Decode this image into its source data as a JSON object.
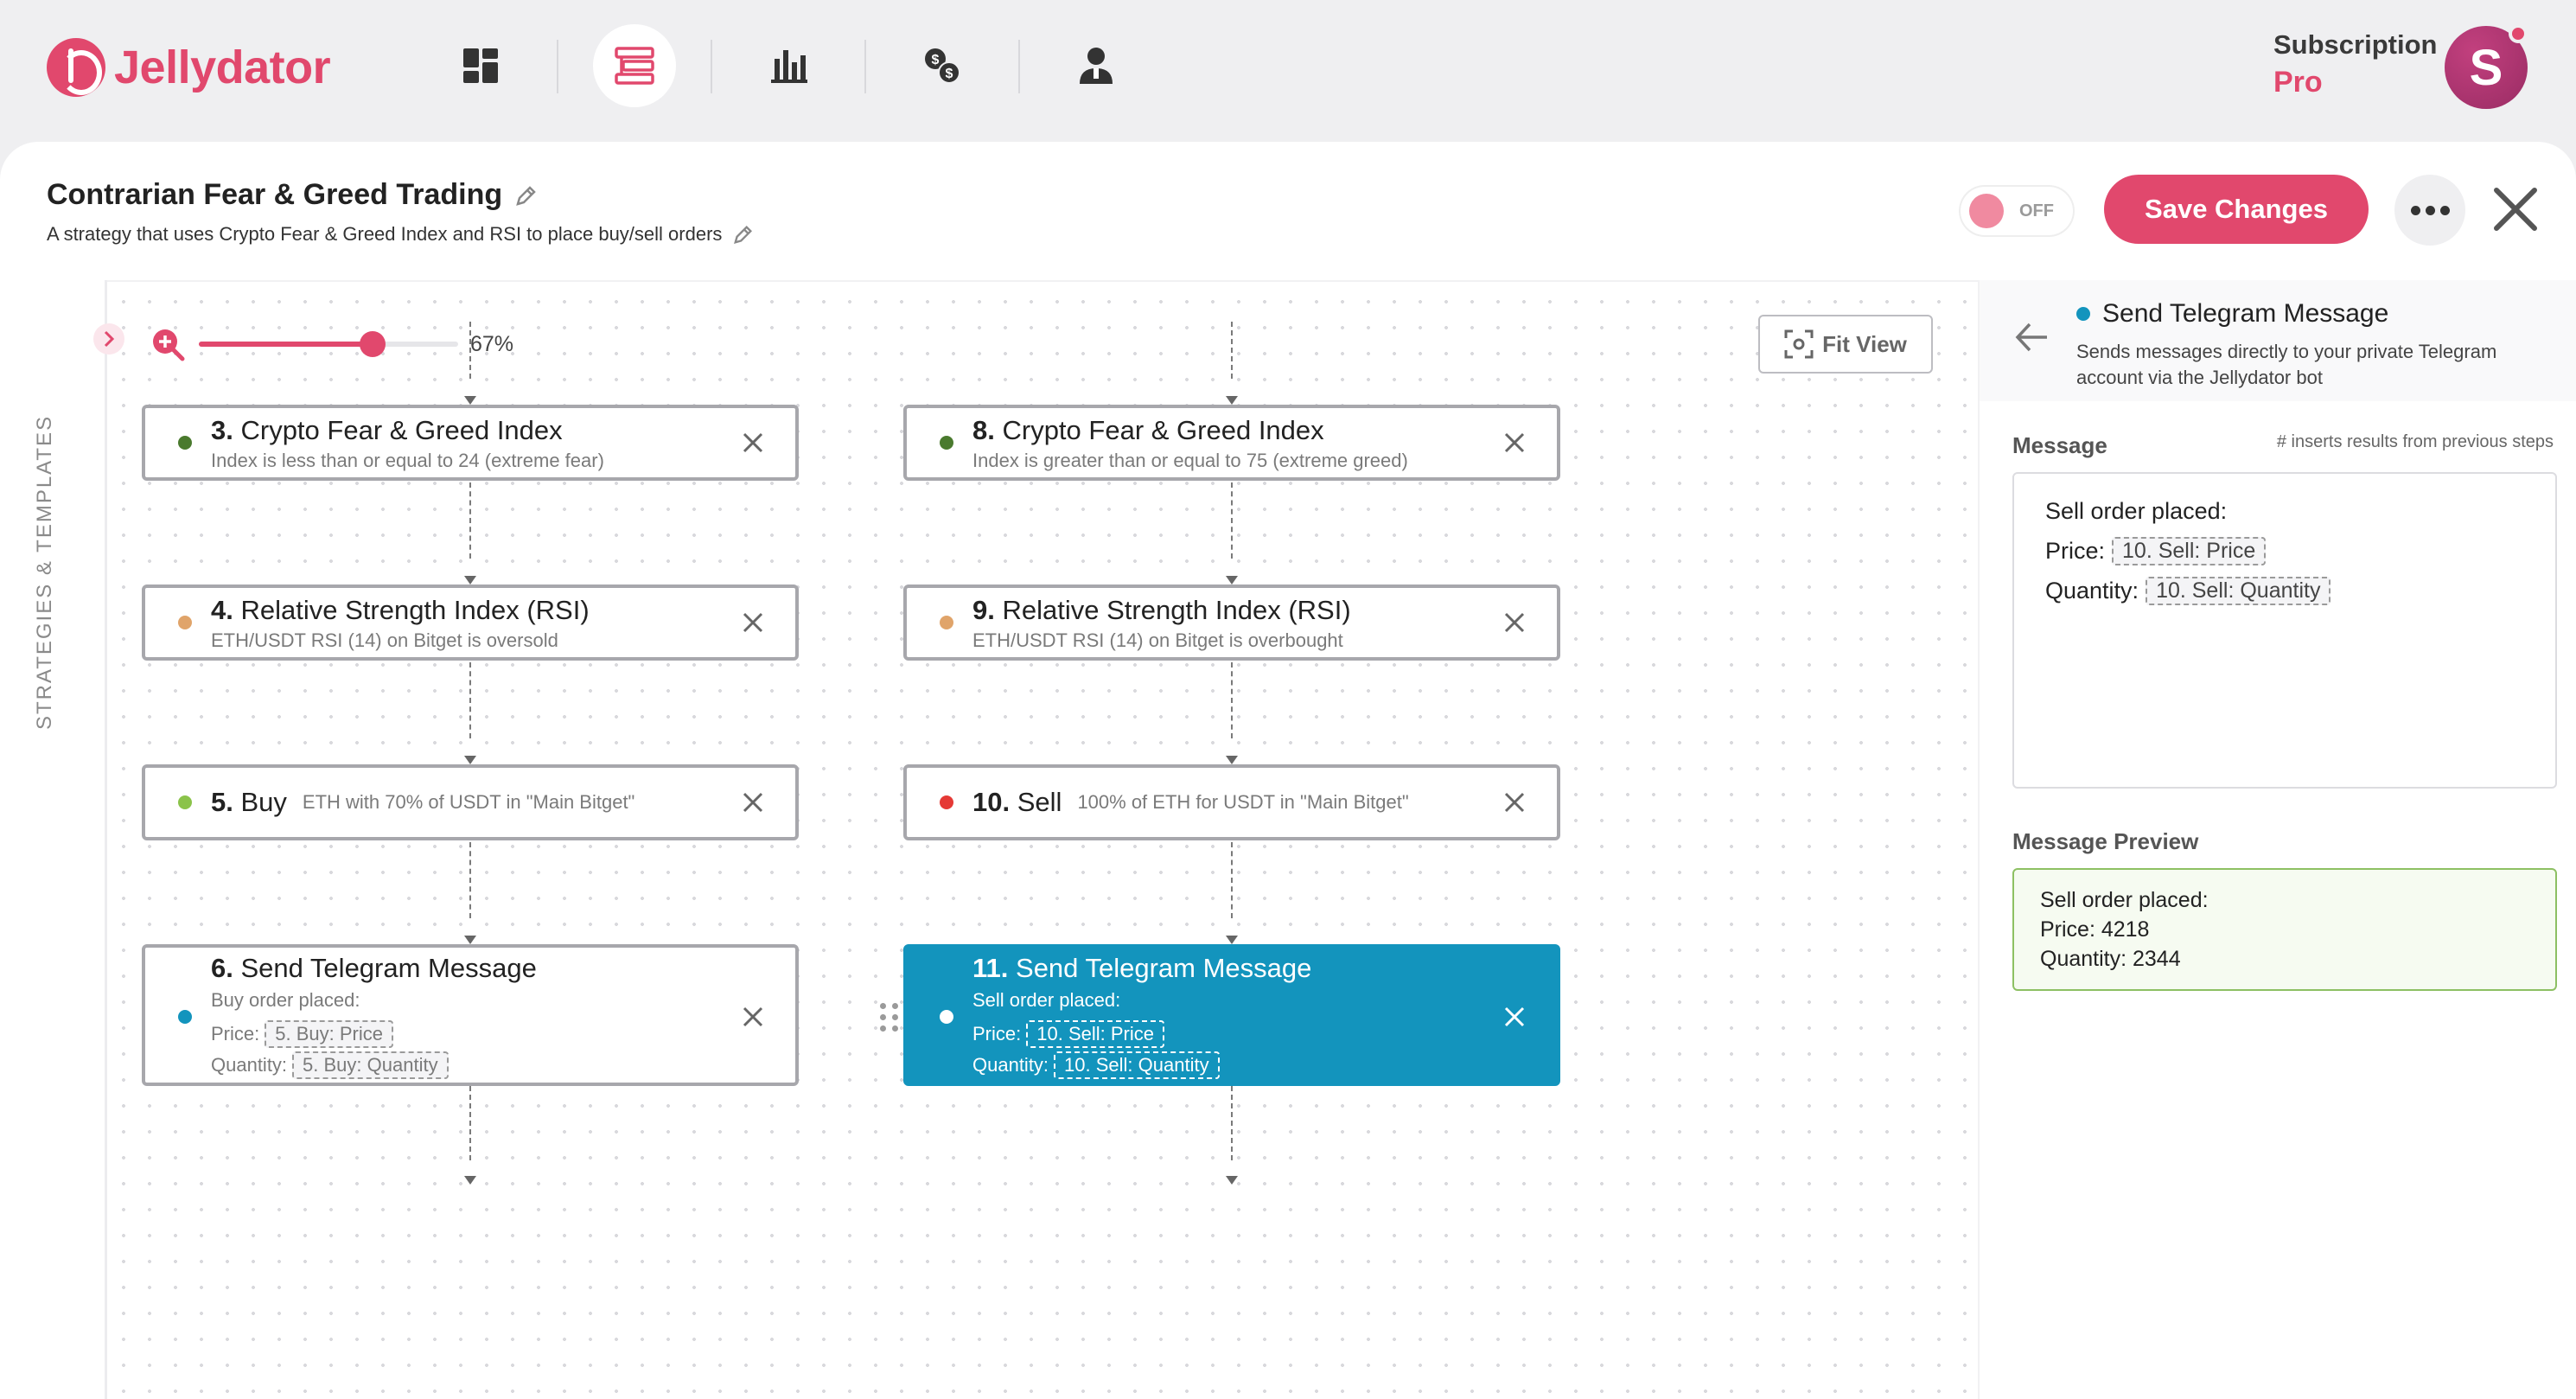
{
  "app": {
    "name": "Jellydator"
  },
  "nav": {
    "items": [
      {
        "icon": "dashboard-icon"
      },
      {
        "icon": "strategies-icon",
        "active": true
      },
      {
        "icon": "bar-chart-icon"
      },
      {
        "icon": "exchange-currency-icon"
      },
      {
        "icon": "user-icon"
      }
    ]
  },
  "account": {
    "subscription_label": "Subscription",
    "plan": "Pro",
    "avatar_initial": "S"
  },
  "strategy": {
    "title": "Contrarian Fear & Greed Trading",
    "description": "A strategy that uses Crypto Fear & Greed Index and RSI to place buy/sell orders",
    "toggle_label": "OFF",
    "save_label": "Save Changes"
  },
  "sidebar": {
    "label": "STRATEGIES & TEMPLATES"
  },
  "canvas": {
    "zoom": {
      "value": 0.67,
      "label": "67%"
    },
    "fit_view_label": "Fit View"
  },
  "colors": {
    "accent": "#e1486d",
    "selected": "#1394bd",
    "condition": "#4a7a2e",
    "rsi": "#e0a46a",
    "buy": "#8bc34a",
    "sell": "#e53935",
    "message": "#1394bd"
  },
  "nodes": {
    "n3": {
      "num": "3.",
      "title": "Crypto Fear & Greed Index",
      "sub": "Index is less than or equal to 24 (extreme fear)"
    },
    "n8": {
      "num": "8.",
      "title": "Crypto Fear & Greed Index",
      "sub": "Index is greater than or equal to 75 (extreme greed)"
    },
    "n4": {
      "num": "4.",
      "title": "Relative Strength Index (RSI)",
      "sub": "ETH/USDT RSI (14) on Bitget is oversold"
    },
    "n9": {
      "num": "9.",
      "title": "Relative Strength Index (RSI)",
      "sub": "ETH/USDT RSI (14) on Bitget is overbought"
    },
    "n5": {
      "num": "5.",
      "title": "Buy",
      "sub": "ETH with 70% of USDT in \"Main Bitget\""
    },
    "n10": {
      "num": "10.",
      "title": "Sell",
      "sub": "100% of ETH for USDT in \"Main Bitget\""
    },
    "n6": {
      "num": "6.",
      "title": "Send Telegram Message",
      "line1": "Buy order placed:",
      "price_label": "Price:",
      "price_chip": "5. Buy: Price",
      "qty_label": "Quantity:",
      "qty_chip": "5. Buy: Quantity"
    },
    "n11": {
      "num": "11.",
      "title": "Send Telegram Message",
      "line1": "Sell order placed:",
      "price_label": "Price:",
      "price_chip": "10. Sell: Price",
      "qty_label": "Quantity:",
      "qty_chip": "10. Sell: Quantity"
    }
  },
  "details": {
    "title": "Send Telegram Message",
    "description": "Sends messages directly to your private Telegram account via the Jellydator bot",
    "message_label": "Message",
    "hint": "# inserts results from previous steps",
    "message": {
      "line1": "Sell order placed:",
      "price_label": "Price:",
      "price_chip": "10. Sell: Price",
      "qty_label": "Quantity:",
      "qty_chip": "10. Sell: Quantity"
    },
    "preview_label": "Message Preview",
    "preview": {
      "line1": "Sell order placed:",
      "line2": "Price: 4218",
      "line3": "Quantity: 2344"
    }
  }
}
